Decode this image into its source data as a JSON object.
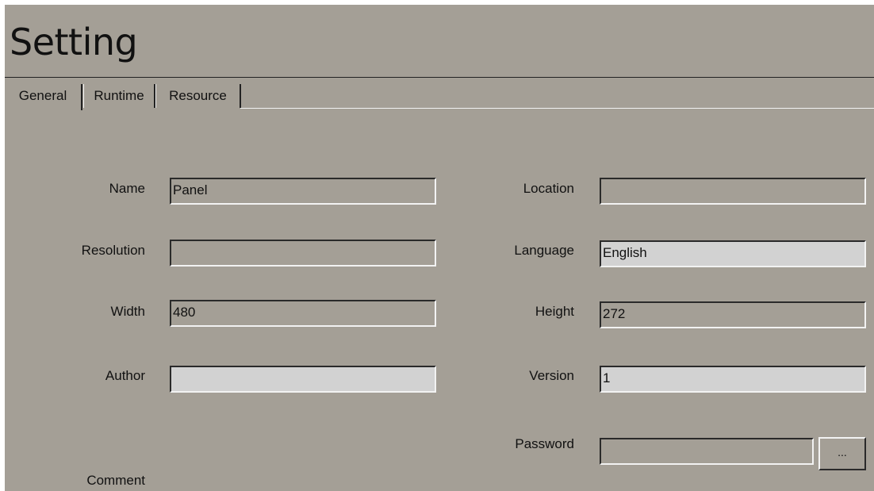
{
  "title": "Setting",
  "tabs": [
    {
      "label": "General",
      "active": true
    },
    {
      "label": "Runtime",
      "active": false
    },
    {
      "label": "Resource",
      "active": false
    }
  ],
  "fields": {
    "name": {
      "label": "Name",
      "value": "Panel"
    },
    "resolution": {
      "label": "Resolution",
      "value": ""
    },
    "width": {
      "label": "Width",
      "value": "480"
    },
    "author": {
      "label": "Author",
      "value": ""
    },
    "comment": {
      "label": "Comment"
    },
    "location": {
      "label": "Location",
      "value": ""
    },
    "language": {
      "label": "Language",
      "value": "English"
    },
    "height": {
      "label": "Height",
      "value": "272"
    },
    "version": {
      "label": "Version",
      "value": "1"
    },
    "password": {
      "label": "Password",
      "value": "",
      "browse_label": "..."
    }
  },
  "colors": {
    "panel_background": "#a49f96",
    "editable_field_background": "#d2d2d2",
    "readonly_field_background": "#a49f96"
  }
}
